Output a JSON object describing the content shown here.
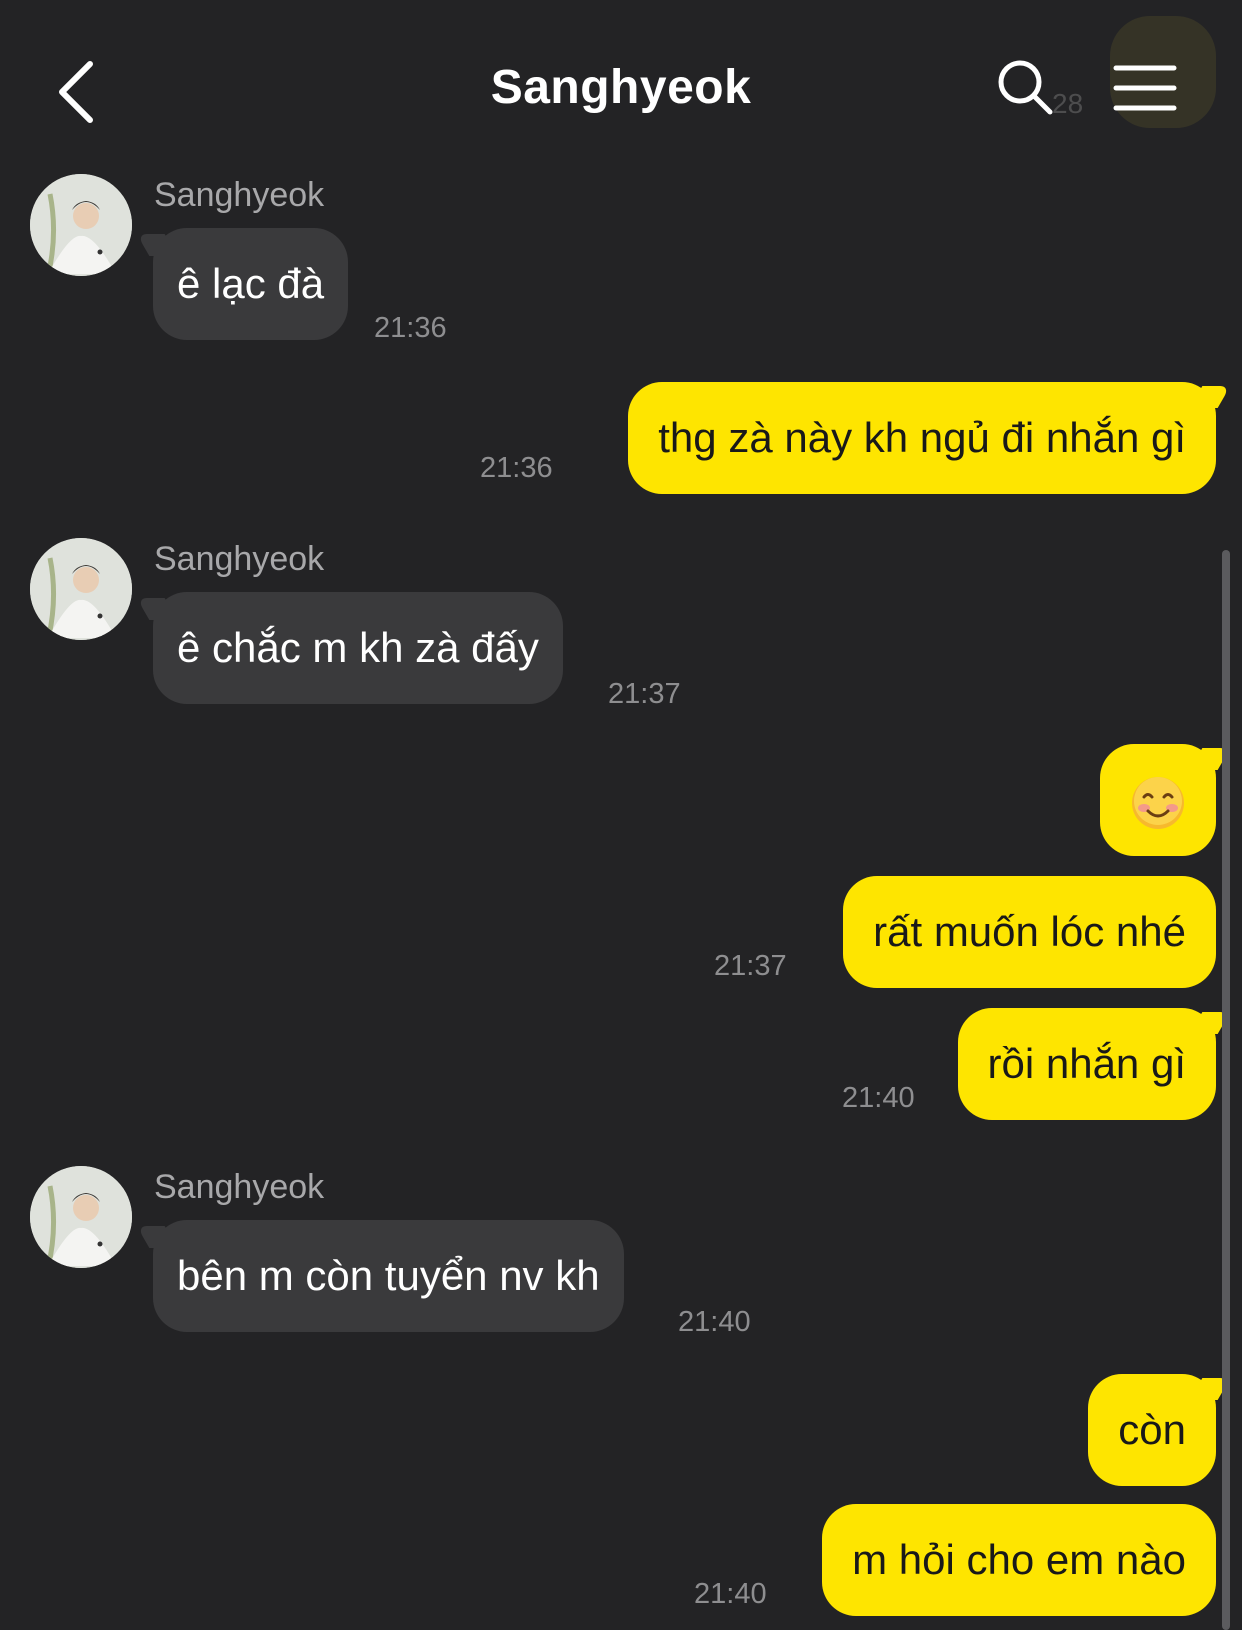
{
  "header": {
    "title": "Sanghyeok",
    "ghost_time": "28"
  },
  "colors": {
    "background": "#232325",
    "incoming_bubble": "#3a3a3c",
    "outgoing_bubble": "#fee500"
  },
  "messages": [
    {
      "direction": "in",
      "sender": "Sanghyeok",
      "text": "ê lạc đà",
      "time": "21:36"
    },
    {
      "direction": "out",
      "text": "thg zà này kh ngủ đi nhắn gì",
      "time": "21:36"
    },
    {
      "direction": "in",
      "sender": "Sanghyeok",
      "text": "ê chắc m kh zà đấy",
      "time": "21:37"
    },
    {
      "direction": "out",
      "text": "☺️",
      "time": ""
    },
    {
      "direction": "out",
      "text": "rất muốn lóc nhé",
      "time": "21:37"
    },
    {
      "direction": "out",
      "text": "rồi nhắn gì",
      "time": "21:40"
    },
    {
      "direction": "in",
      "sender": "Sanghyeok",
      "text": "bên m còn tuyển nv kh",
      "time": "21:40"
    },
    {
      "direction": "out",
      "text": "còn",
      "time": ""
    },
    {
      "direction": "out",
      "text": "m hỏi cho em nào",
      "time": "21:40"
    }
  ]
}
